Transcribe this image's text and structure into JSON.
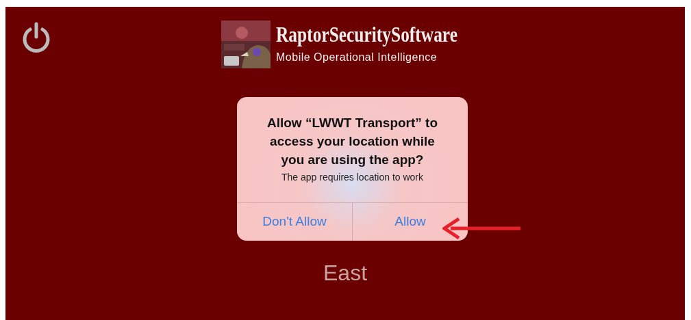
{
  "header": {
    "title": "RaptorSecuritySoftware",
    "subtitle": "Mobile Operational Intelligence"
  },
  "dialog": {
    "title": "Allow “LWWT Transport” to access your location while you are using the app?",
    "message": "The app requires location to work",
    "buttons": [
      {
        "label": "Don't Allow"
      },
      {
        "label": "Allow"
      }
    ]
  },
  "region": "East"
}
